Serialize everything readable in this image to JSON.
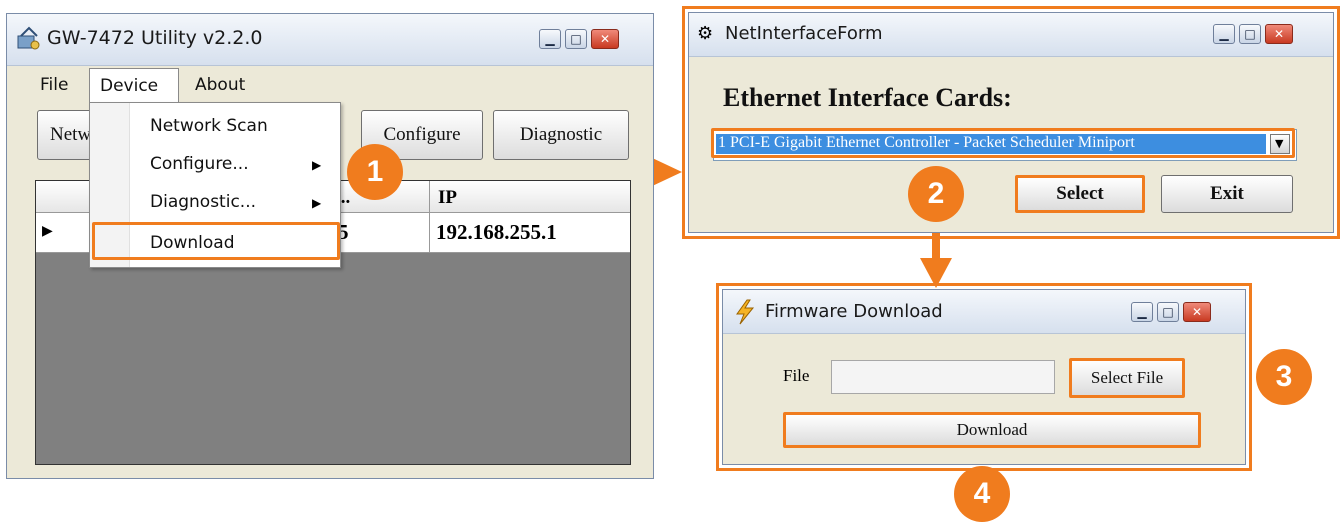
{
  "main_window": {
    "title": "GW-7472 Utility v2.2.0",
    "menu": [
      "File",
      "Device",
      "About"
    ],
    "toolbar": {
      "network_partial": "Netw",
      "configure": "Configure",
      "diagnostic": "Diagnostic"
    },
    "grid": {
      "headers": [
        "...",
        "IP"
      ],
      "row": {
        "marker": "▶",
        "left_cell": "5",
        "ip": "192.168.255.1"
      }
    },
    "device_menu": {
      "items": [
        "Network Scan",
        "Configure...",
        "Diagnostic...",
        "Download"
      ],
      "submenu_arrow": "▶"
    }
  },
  "net_window": {
    "title": "NetInterfaceForm",
    "heading": "Ethernet Interface Cards:",
    "dropdown_value": "1 PCI-E Gigabit Ethernet Controller - Packet Scheduler Miniport",
    "select_label": "Select",
    "exit_label": "Exit"
  },
  "fw_window": {
    "title": "Firmware Download",
    "file_label": "File",
    "file_value": "",
    "select_file_label": "Select File",
    "download_label": "Download"
  },
  "steps": [
    "1",
    "2",
    "3",
    "4"
  ],
  "colors": {
    "accent": "#f07c1e",
    "grid_empty": "#808080",
    "selection": "#3d8ee0"
  }
}
